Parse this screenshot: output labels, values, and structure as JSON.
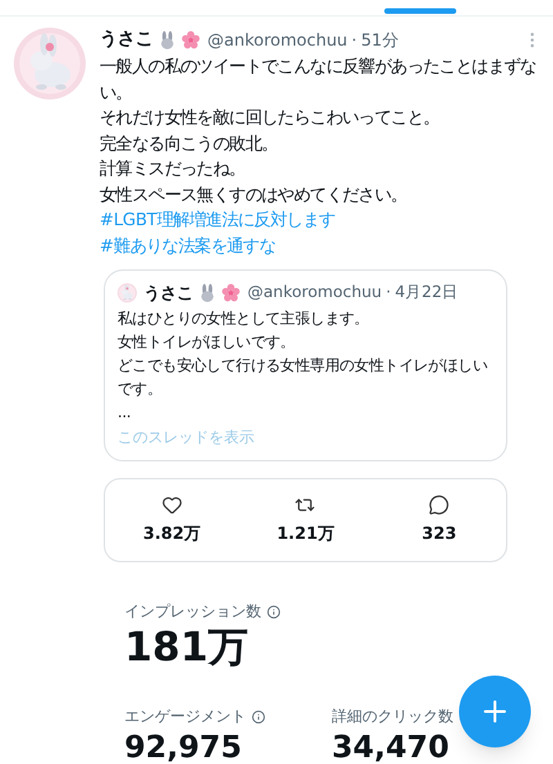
{
  "tweet": {
    "author": {
      "name": "うさこ",
      "handle": "@ankoromochuu",
      "separator": "·",
      "time": "51分"
    },
    "lines": [
      {
        "kind": "text",
        "text": "一般人の私のツイートでこんなに反響があったことはまずない。"
      },
      {
        "kind": "text",
        "text": "それだけ女性を敵に回したらこわいってこと。"
      },
      {
        "kind": "text",
        "text": "完全なる向こうの敗北。"
      },
      {
        "kind": "text",
        "text": "計算ミスだったね。"
      },
      {
        "kind": "text",
        "text": "女性スペース無くすのはやめてください。"
      },
      {
        "kind": "hashtag",
        "text": "#LGBT理解増進法に反対します"
      },
      {
        "kind": "hashtag",
        "text": "#難ありな法案を通すな"
      }
    ],
    "quote": {
      "name": "うさこ",
      "handle": "@ankoromochuu",
      "separator": "·",
      "time": "4月22日",
      "lines": [
        "私はひとりの女性として主張します。",
        "女性トイレがほしいです。",
        "どこでも安心して行ける女性専用の女性トイレがほしいです。",
        "..."
      ],
      "thread_link": "このスレッドを表示"
    },
    "stats": [
      {
        "kind": "like",
        "value": "3.82万"
      },
      {
        "kind": "retweet",
        "value": "1.21万"
      },
      {
        "kind": "reply",
        "value": "323"
      }
    ],
    "impressions": {
      "label": "インプレッション数",
      "value": "181万"
    },
    "metrics": [
      {
        "label": "エンゲージメント",
        "value": "92,975"
      },
      {
        "label": "詳細のクリック数",
        "value": "34,470"
      }
    ]
  }
}
